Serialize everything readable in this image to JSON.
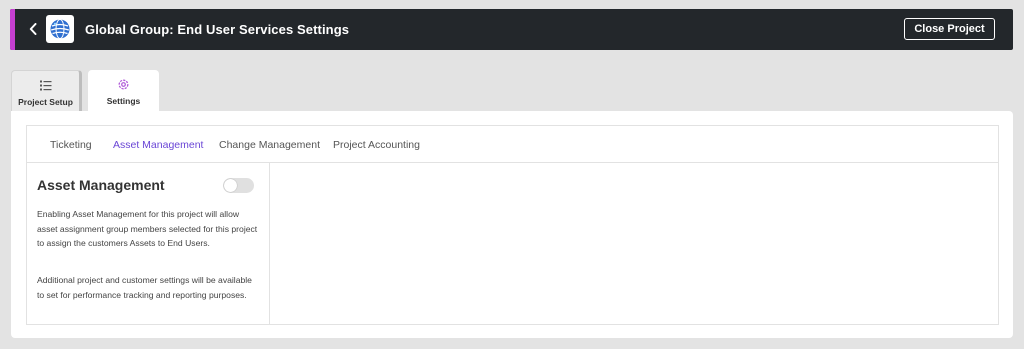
{
  "header": {
    "title": "Global Group: End User Services Settings",
    "close_label": "Close Project",
    "accent_color": "#c63fd1",
    "back_icon": "chevron-left-icon",
    "logo_icon": "globe-logo-icon"
  },
  "tabs": [
    {
      "label": "Project Setup",
      "icon": "checklist-icon",
      "active": false
    },
    {
      "label": "Settings",
      "icon": "gear-icon",
      "active": true
    }
  ],
  "subtabs": [
    {
      "label": "Ticketing",
      "active": false
    },
    {
      "label": "Asset Management",
      "active": true
    },
    {
      "label": "Change Management",
      "active": false
    },
    {
      "label": "Project Accounting",
      "active": false
    }
  ],
  "panel": {
    "title": "Asset Management",
    "toggle_on": false,
    "paragraph1": "Enabling Asset Management for this project will allow asset assignment group members selected for this project to assign the customers Assets to End Users.",
    "paragraph2": "Additional project and customer settings will be available to set for performance tracking and reporting purposes."
  },
  "colors": {
    "active_subtab": "#6a46d6",
    "header_bg": "#23272b"
  }
}
